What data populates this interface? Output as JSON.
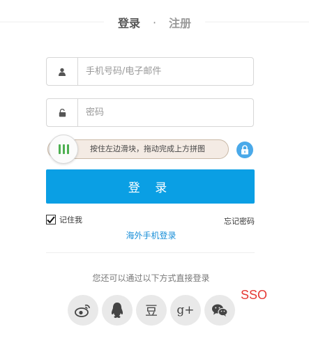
{
  "tabs": {
    "login": "登录",
    "separator": "·",
    "register": "注册"
  },
  "username": {
    "placeholder": "手机号码/电子邮件",
    "value": ""
  },
  "password": {
    "placeholder": "密码",
    "value": ""
  },
  "slider": {
    "text": "按住左边滑块，拖动完成上方拼图",
    "progress": 0
  },
  "login_button": "登 录",
  "remember": {
    "label": "记住我",
    "checked": true
  },
  "forgot_password": "忘记密码",
  "overseas_login": "海外手机登录",
  "other_methods": "您还可以通过以下方式直接登录",
  "social": [
    {
      "icon": "weibo-icon"
    },
    {
      "icon": "qq-icon"
    },
    {
      "icon": "douban-icon",
      "glyph": "豆"
    },
    {
      "icon": "google-plus-icon",
      "glyph": "g+"
    },
    {
      "icon": "wechat-icon"
    }
  ],
  "annotation": "SSO",
  "colors": {
    "primary": "#0a9fe4",
    "link": "#1a8fd8",
    "annotation": "#e53935",
    "slider_grip": "#4caf50",
    "lock": "#4aa9e9"
  }
}
